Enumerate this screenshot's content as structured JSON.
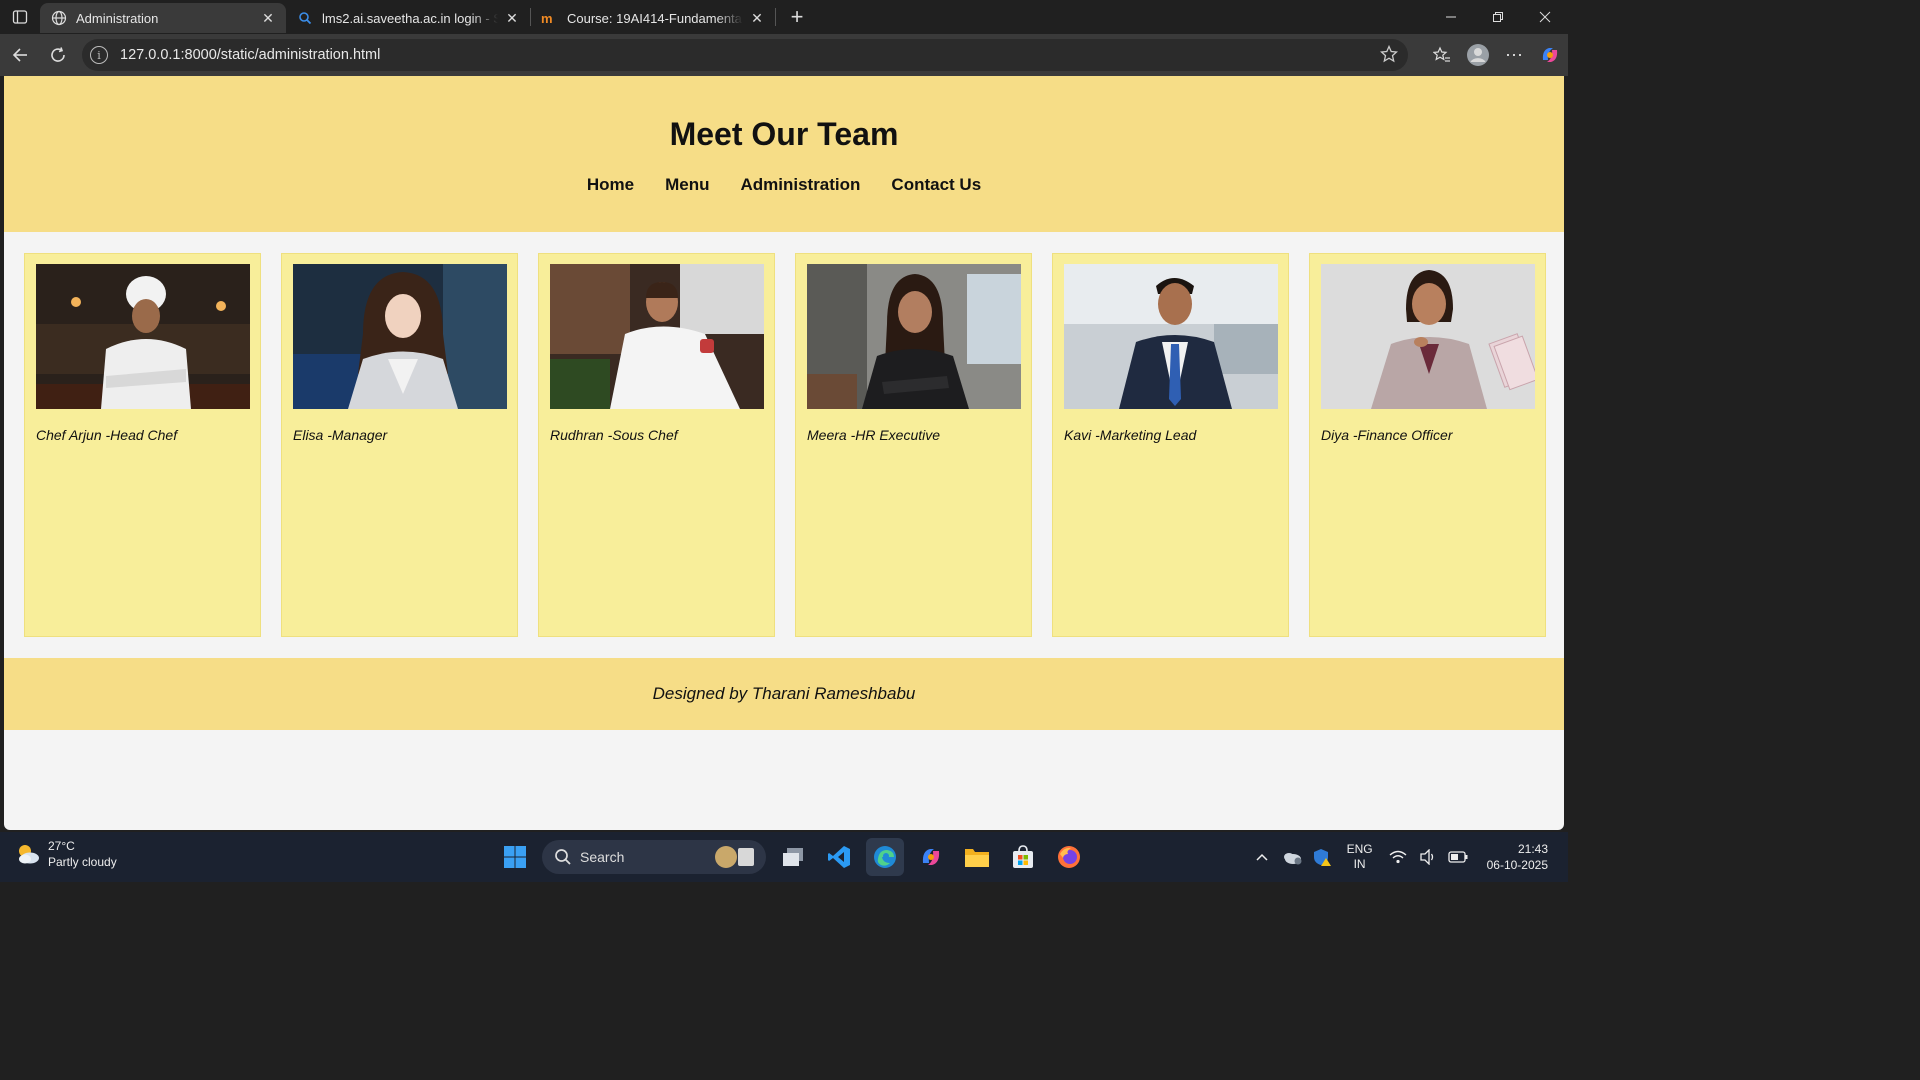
{
  "browser": {
    "tabs": [
      {
        "title": "Administration",
        "active": true,
        "icon": "globe-icon"
      },
      {
        "title": "lms2.ai.saveetha.ac.in login - Sear",
        "active": false,
        "icon": "search-icon"
      },
      {
        "title": "Course: 19AI414-Fundamentals of",
        "active": false,
        "icon": "moodle-icon"
      }
    ],
    "url": "127.0.0.1:8000/static/administration.html"
  },
  "page": {
    "title": "Meet Our Team",
    "nav": [
      "Home",
      "Menu",
      "Administration",
      "Contact Us"
    ],
    "team": [
      {
        "caption": "Chef Arjun -Head Chef",
        "photo": "chef-photo"
      },
      {
        "caption": "Elisa -Manager",
        "photo": "manager-photo"
      },
      {
        "caption": "Rudhran -Sous Chef",
        "photo": "sous-chef-photo"
      },
      {
        "caption": "Meera -HR Executive",
        "photo": "hr-photo"
      },
      {
        "caption": "Kavi -Marketing Lead",
        "photo": "marketing-photo"
      },
      {
        "caption": "Diya -Finance Officer",
        "photo": "finance-photo"
      }
    ],
    "footer": "Designed by Tharani Rameshbabu",
    "colors": {
      "header": "#f6dd87",
      "card": "#f8ee9a",
      "background": "#f4f4f4"
    }
  },
  "taskbar": {
    "weather": {
      "temp": "27°C",
      "desc": "Partly cloudy"
    },
    "search_label": "Search",
    "lang": [
      "ENG",
      "IN"
    ],
    "time": "21:43",
    "date": "06-10-2025"
  }
}
